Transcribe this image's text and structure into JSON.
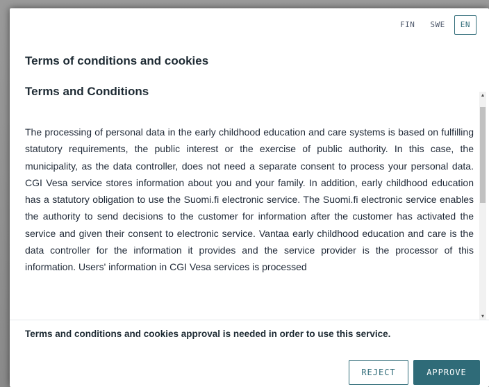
{
  "languages": [
    {
      "label": "FIN",
      "active": false
    },
    {
      "label": "SWE",
      "active": false
    },
    {
      "label": "EN",
      "active": true
    }
  ],
  "dialog": {
    "title": "Terms of conditions and cookies",
    "section_heading": "Terms and Conditions",
    "body_text": "The processing of personal data in the early childhood education and care systems is based on fulfilling statutory requirements, the public interest or the exercise of public authority. In this case, the municipality, as the data controller, does not need a separate consent to process your personal data. CGI Vesa service stores information about you and your family. In addition, early childhood education has a statutory obligation to use the Suomi.fi electronic service. The Suomi.fi electronic service enables the authority to send decisions to the customer for information after the customer has activated the service and given their consent to electronic service. Vantaa early childhood education and care is the data controller for the information it provides and the service provider is the processor of this information. Users' information in CGI Vesa services is processed",
    "notice": "Terms and conditions and cookies approval is needed in order to use this service.",
    "reject_label": "REJECT",
    "approve_label": "APPROVE"
  },
  "colors": {
    "accent": "#2f6b78",
    "text": "#1d2a33",
    "backdrop": "#8f8f8f"
  },
  "icons": {
    "scroll_up": "triangle-up-icon",
    "scroll_down": "triangle-down-icon"
  }
}
